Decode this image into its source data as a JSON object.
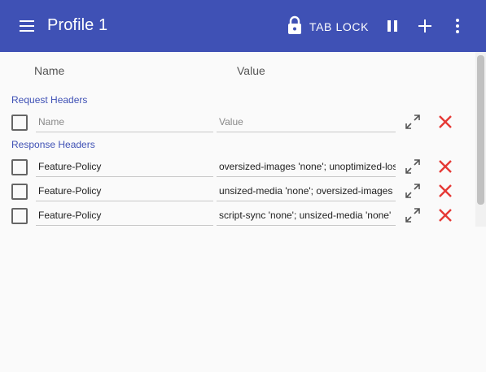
{
  "appbar": {
    "title": "Profile 1",
    "tab_lock_label": "TAB LOCK",
    "color": "#3f51b5",
    "icons": [
      "menu-icon",
      "lock-icon",
      "pause-icon",
      "plus-icon",
      "more-vert-icon"
    ]
  },
  "columns": {
    "name": "Name",
    "value": "Value"
  },
  "request_headers": {
    "label": "Request Headers",
    "rows": [
      {
        "name": "",
        "value": "",
        "name_placeholder": "Name",
        "value_placeholder": "Value"
      }
    ]
  },
  "response_headers": {
    "label": "Response Headers",
    "rows": [
      {
        "name": "Feature-Policy",
        "value": "oversized-images 'none'; unoptimized-lossy-images 'none'"
      },
      {
        "name": "Feature-Policy",
        "value": "unsized-media 'none'; oversized-images 'none'"
      },
      {
        "name": "Feature-Policy",
        "value": "script-sync 'none'; unsized-media 'none'"
      }
    ]
  },
  "colors": {
    "accent": "#3f51b5",
    "delete": "#e53935"
  }
}
